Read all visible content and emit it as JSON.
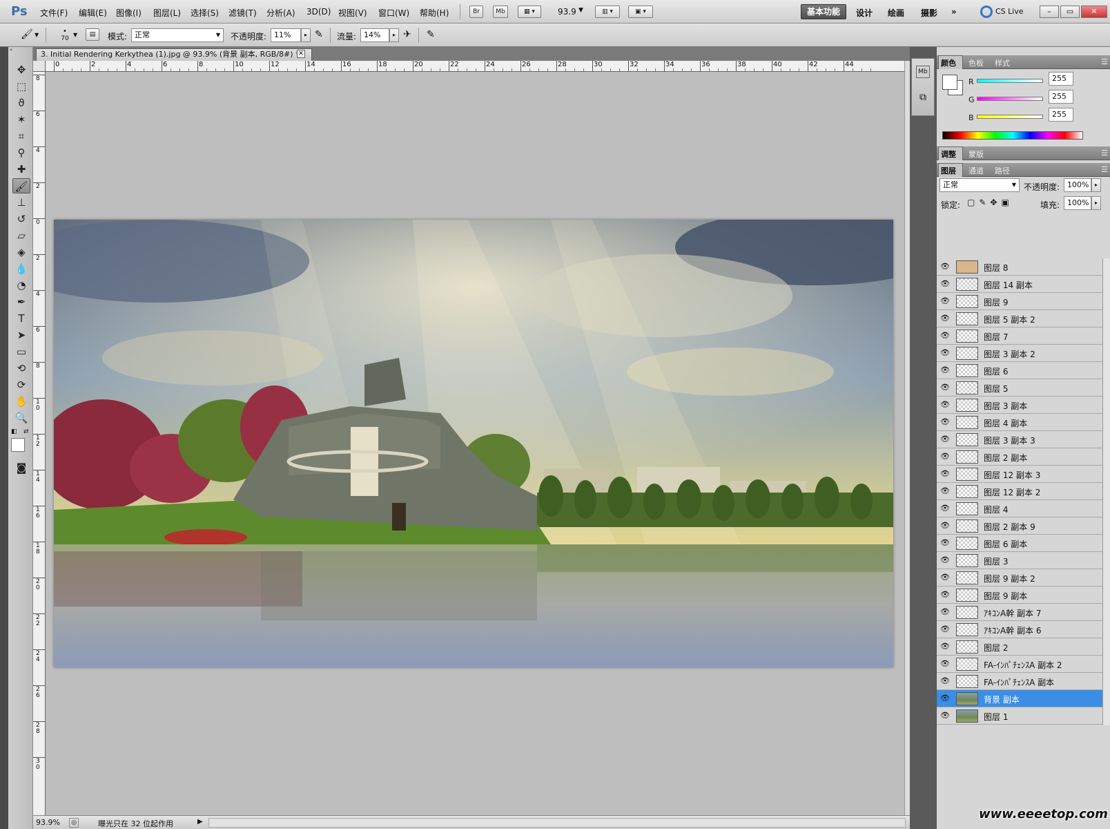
{
  "app": {
    "logo": "Ps",
    "menu": [
      "文件(F)",
      "编辑(E)",
      "图像(I)",
      "图层(L)",
      "选择(S)",
      "滤镜(T)",
      "分析(A)",
      "3D(D)",
      "视图(V)",
      "窗口(W)",
      "帮助(H)"
    ],
    "bridge_btn": "Br",
    "minibridge_btn": "Mb",
    "zoom_value": "93.9",
    "workspaces": [
      "基本功能",
      "设计",
      "绘画",
      "摄影"
    ],
    "more_ws": "»",
    "cs_live": "CS Live",
    "win_min": "–",
    "win_max": "▭",
    "win_close": "✕"
  },
  "options": {
    "brush_size": "70",
    "mode_label": "模式:",
    "mode_value": "正常",
    "opacity_label": "不透明度:",
    "opacity_value": "11%",
    "flow_label": "流量:",
    "flow_value": "14%"
  },
  "document": {
    "tab_title": "3. Initial Rendering Kerkythea (1).jpg @ 93.9% (背景 副本, RGB/8#) *",
    "ruler_h_ticks": [
      "0",
      "2",
      "4",
      "6",
      "8",
      "10",
      "12",
      "14",
      "16",
      "18",
      "20",
      "22",
      "24",
      "26",
      "28",
      "30",
      "32",
      "34",
      "36",
      "38",
      "40",
      "42",
      "44"
    ],
    "ruler_v_ticks": [
      "8",
      "6",
      "4",
      "2",
      "0",
      "2",
      "4",
      "6",
      "8",
      "1\n0",
      "1\n2",
      "1\n4",
      "1\n6",
      "1\n8",
      "2\n0",
      "2\n2",
      "2\n4",
      "2\n6",
      "2\n8",
      "3\n0"
    ],
    "status_zoom": "93.9%",
    "status_text": "曝光只在 32 位起作用"
  },
  "color_panel": {
    "tabs": [
      "颜色",
      "色板",
      "样式"
    ],
    "r_label": "R",
    "g_label": "G",
    "b_label": "B",
    "r_value": "255",
    "g_value": "255",
    "b_value": "255"
  },
  "adjust_panel": {
    "tabs": [
      "调整",
      "蒙版"
    ]
  },
  "layers_panel": {
    "tabs": [
      "图层",
      "通道",
      "路径"
    ],
    "blend_mode": "正常",
    "opacity_label": "不透明度:",
    "opacity_value": "100%",
    "lock_label": "锁定:",
    "fill_label": "填充:",
    "fill_value": "100%",
    "layers": [
      {
        "name": "图层 8"
      },
      {
        "name": "图层 14 副本"
      },
      {
        "name": "图层 9"
      },
      {
        "name": "图层 5 副本 2"
      },
      {
        "name": "图层 7"
      },
      {
        "name": "图层 3 副本 2"
      },
      {
        "name": "图层 6"
      },
      {
        "name": "图层 5"
      },
      {
        "name": "图层 3 副本"
      },
      {
        "name": "图层 4 副本"
      },
      {
        "name": "图层 3 副本 3"
      },
      {
        "name": "图层 2 副本"
      },
      {
        "name": "图层 12 副本 3"
      },
      {
        "name": "图层 12 副本 2"
      },
      {
        "name": "图层 4"
      },
      {
        "name": "图层 2 副本 9"
      },
      {
        "name": "图层 6 副本"
      },
      {
        "name": "图层 3"
      },
      {
        "name": "图层 9 副本 2"
      },
      {
        "name": "图层 9 副本"
      },
      {
        "name": "ｱｷｺﾝA幹 副本 7"
      },
      {
        "name": "ｱｷｺﾝA幹 副本 6"
      },
      {
        "name": "图层 2"
      },
      {
        "name": "FA-ｲﾝﾊﾟﾁｪﾝｽA 副本 2"
      },
      {
        "name": "FA-ｲﾝﾊﾟﾁｪﾝｽA 副本"
      },
      {
        "name": "背景 副本",
        "selected": true
      },
      {
        "name": "图层 1"
      }
    ]
  },
  "watermark": "www.eeeetop.com",
  "colors": {
    "selection_blue": "#3a8ee6",
    "r_slider": "#40e0e0",
    "g_slider": "#e040e0",
    "b_slider": "#e0e040"
  }
}
